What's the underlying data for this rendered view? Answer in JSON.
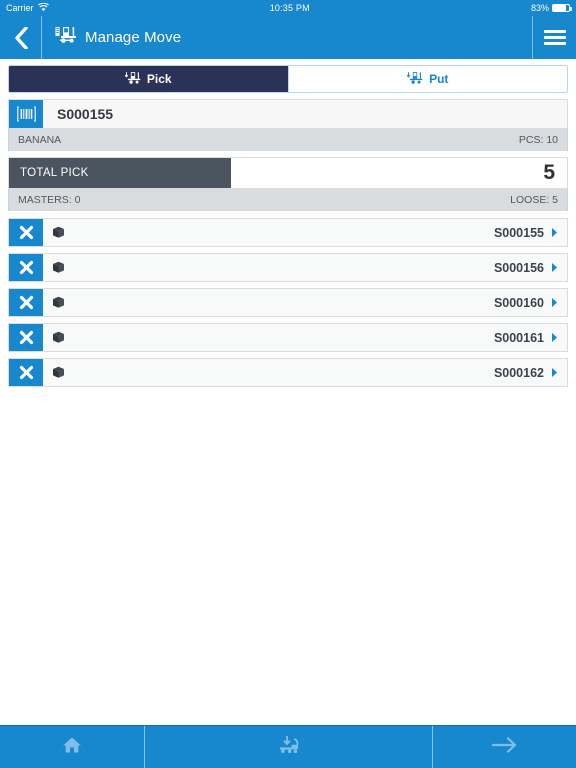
{
  "statusbar": {
    "carrier": "Carrier",
    "wifi_icon": "wifi-icon",
    "time": "10:35 PM",
    "battery_percent": "83%",
    "battery_level": 83,
    "battery_icon": "battery-icon"
  },
  "navbar": {
    "back_icon": "chevron-left-icon",
    "title_icon": "forklift-icon",
    "title": "Manage Move",
    "menu_icon": "hamburger-menu-icon"
  },
  "tabs": [
    {
      "label": "Pick",
      "icon": "forklift-pick-icon",
      "active": true
    },
    {
      "label": "Put",
      "icon": "forklift-put-icon",
      "active": false
    }
  ],
  "card": {
    "barcode_icon": "barcode-icon",
    "id": "S000155",
    "description": "BANANA",
    "pcs_label": "PCS: 10"
  },
  "total": {
    "label": "TOTAL PICK",
    "value": "5",
    "masters": "MASTERS: 0",
    "loose": "LOOSE: 5"
  },
  "list": {
    "delete_icon": "close-x-icon",
    "item_icon": "box-icon",
    "chevron_icon": "chevron-right-icon",
    "rows": [
      {
        "id": "S000155"
      },
      {
        "id": "S000156"
      },
      {
        "id": "S000160"
      },
      {
        "id": "S000161"
      },
      {
        "id": "S000162"
      }
    ]
  },
  "toolbar": {
    "buttons": [
      {
        "name": "home-button",
        "icon": "home-icon"
      },
      {
        "name": "putaway-button",
        "icon": "putaway-forklift-icon"
      },
      {
        "name": "next-button",
        "icon": "arrow-right-icon"
      }
    ]
  },
  "colors": {
    "brand_blue": "#1787ce",
    "tab_active_navy": "#2b3258",
    "total_slate": "#4a5560",
    "meta_grey": "#d9dcde",
    "row_bg": "#f8f9f9"
  }
}
